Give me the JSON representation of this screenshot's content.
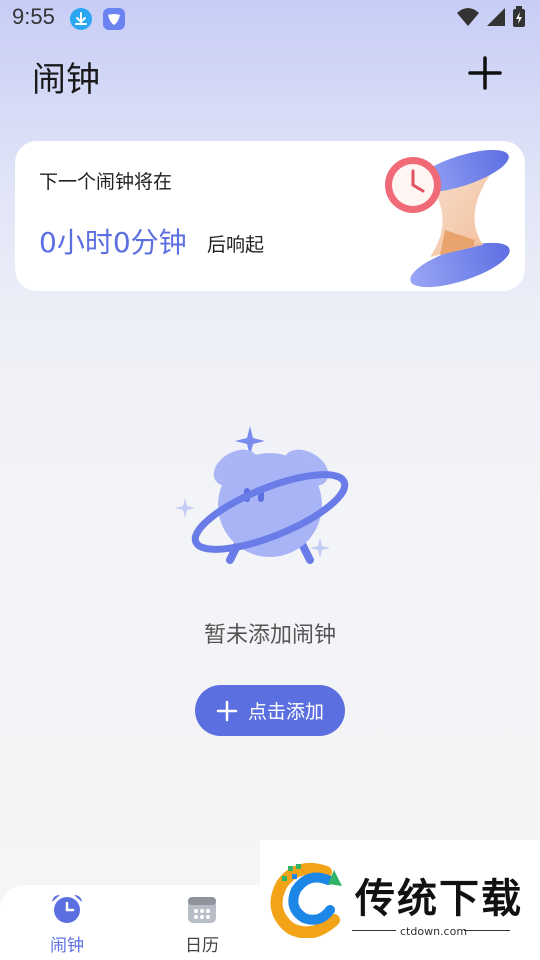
{
  "status_bar": {
    "time": "9:55"
  },
  "header": {
    "title": "闹钟"
  },
  "next_alarm": {
    "label": "下一个闹钟将在",
    "countdown": "0小时0分钟",
    "suffix": "后响起"
  },
  "empty_state": {
    "message": "暂未添加闹钟",
    "add_button_label": "点击添加"
  },
  "bottom_nav": {
    "items": [
      {
        "label": "闹钟",
        "icon": "alarm-clock-icon",
        "active": true
      },
      {
        "label": "日历",
        "icon": "calendar-icon",
        "active": false
      }
    ]
  },
  "watermark": {
    "text": "传统下载",
    "url": "ctdown.com"
  },
  "colors": {
    "accent": "#5b6fe0",
    "card": "#ffffff"
  }
}
